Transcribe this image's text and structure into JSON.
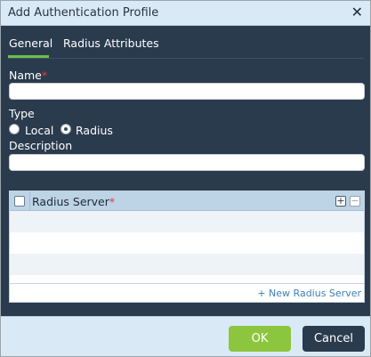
{
  "dialog": {
    "title": "Add Authentication Profile",
    "close_glyph": "✕"
  },
  "tabs": [
    {
      "label": "General",
      "active": true
    },
    {
      "label": "Radius Attributes",
      "active": false
    }
  ],
  "form": {
    "name_label": "Name",
    "name_required_mark": "*",
    "name_value": "",
    "type_label": "Type",
    "type_options": [
      {
        "label": "Local",
        "selected": false
      },
      {
        "label": "Radius",
        "selected": true
      }
    ],
    "description_label": "Description",
    "description_value": ""
  },
  "grid": {
    "column_header": "Radius Server",
    "required_mark": "*",
    "add_glyph": "+",
    "remove_glyph": "−",
    "new_link": "+ New Radius Server"
  },
  "footer": {
    "ok_label": "OK",
    "cancel_label": "Cancel"
  },
  "colors": {
    "panel_bg": "#2b3b4e",
    "titlebar_bg": "#d9eaf6",
    "accent_green": "#8cc63f",
    "tab_underline": "#6cc04a",
    "required_red": "#e43b3b",
    "link_blue": "#3f7fb8"
  }
}
